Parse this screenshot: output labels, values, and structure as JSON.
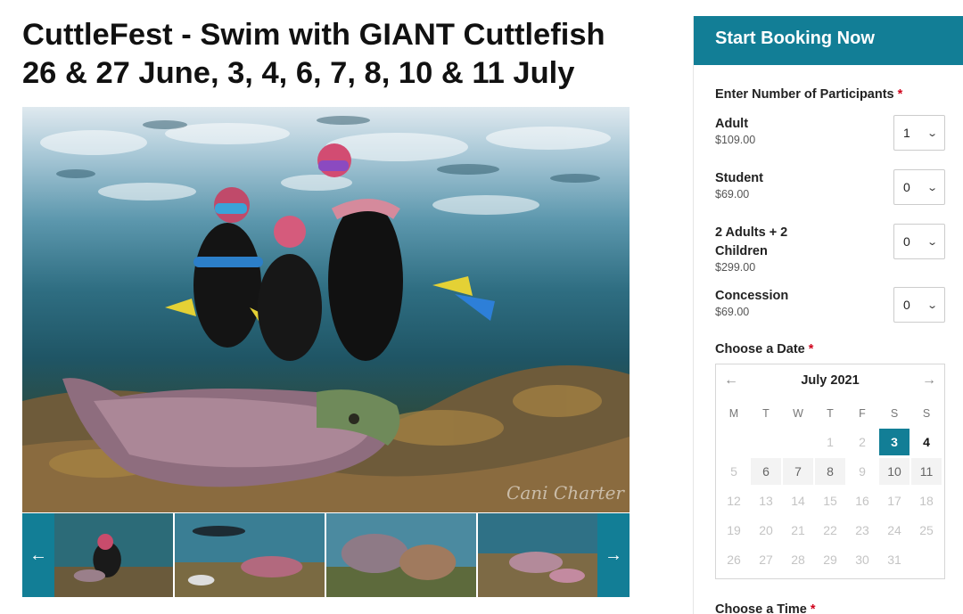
{
  "title": {
    "line1": "CuttleFest - Swim with GIANT Cuttlefish",
    "line2": "26 & 27 June, 3, 4, 6, 7, 8, 10 & 11 July"
  },
  "gallery": {
    "watermark": "Cani Charter",
    "prev_icon": "arrow-left-icon",
    "next_icon": "arrow-right-icon",
    "prev_glyph": "←",
    "next_glyph": "→"
  },
  "booking": {
    "heading": "Start Booking Now",
    "participants_label": "Enter Number of Participants",
    "required_mark": "*",
    "participants": [
      {
        "name": "Adult",
        "price": "$109.00",
        "qty": "1"
      },
      {
        "name": "Student",
        "price": "$69.00",
        "qty": "0"
      },
      {
        "name": "2 Adults + 2 Children",
        "price": "$299.00",
        "qty": "0"
      },
      {
        "name": "Concession",
        "price": "$69.00",
        "qty": "0"
      }
    ],
    "date_label": "Choose a Date",
    "time_label": "Choose a Time",
    "calendar": {
      "month": "July 2021",
      "prev": "←",
      "next": "→",
      "weekdays": [
        "M",
        "T",
        "W",
        "T",
        "F",
        "S",
        "S"
      ],
      "weeks": [
        [
          {
            "d": ""
          },
          {
            "d": ""
          },
          {
            "d": ""
          },
          {
            "d": "1"
          },
          {
            "d": "2"
          },
          {
            "d": "3",
            "s": "selected"
          },
          {
            "d": "4",
            "s": "strong"
          }
        ],
        [
          {
            "d": "5"
          },
          {
            "d": "6",
            "s": "avail"
          },
          {
            "d": "7",
            "s": "avail"
          },
          {
            "d": "8",
            "s": "avail"
          },
          {
            "d": "9"
          },
          {
            "d": "10",
            "s": "avail"
          },
          {
            "d": "11",
            "s": "avail"
          }
        ],
        [
          {
            "d": "12"
          },
          {
            "d": "13"
          },
          {
            "d": "14"
          },
          {
            "d": "15"
          },
          {
            "d": "16"
          },
          {
            "d": "17"
          },
          {
            "d": "18"
          }
        ],
        [
          {
            "d": "19"
          },
          {
            "d": "20"
          },
          {
            "d": "21"
          },
          {
            "d": "22"
          },
          {
            "d": "23"
          },
          {
            "d": "24"
          },
          {
            "d": "25"
          }
        ],
        [
          {
            "d": "26"
          },
          {
            "d": "27"
          },
          {
            "d": "28"
          },
          {
            "d": "29"
          },
          {
            "d": "30"
          },
          {
            "d": "31"
          },
          {
            "d": ""
          }
        ]
      ]
    }
  },
  "colors": {
    "accent": "#127e96",
    "required": "#d0021b"
  }
}
